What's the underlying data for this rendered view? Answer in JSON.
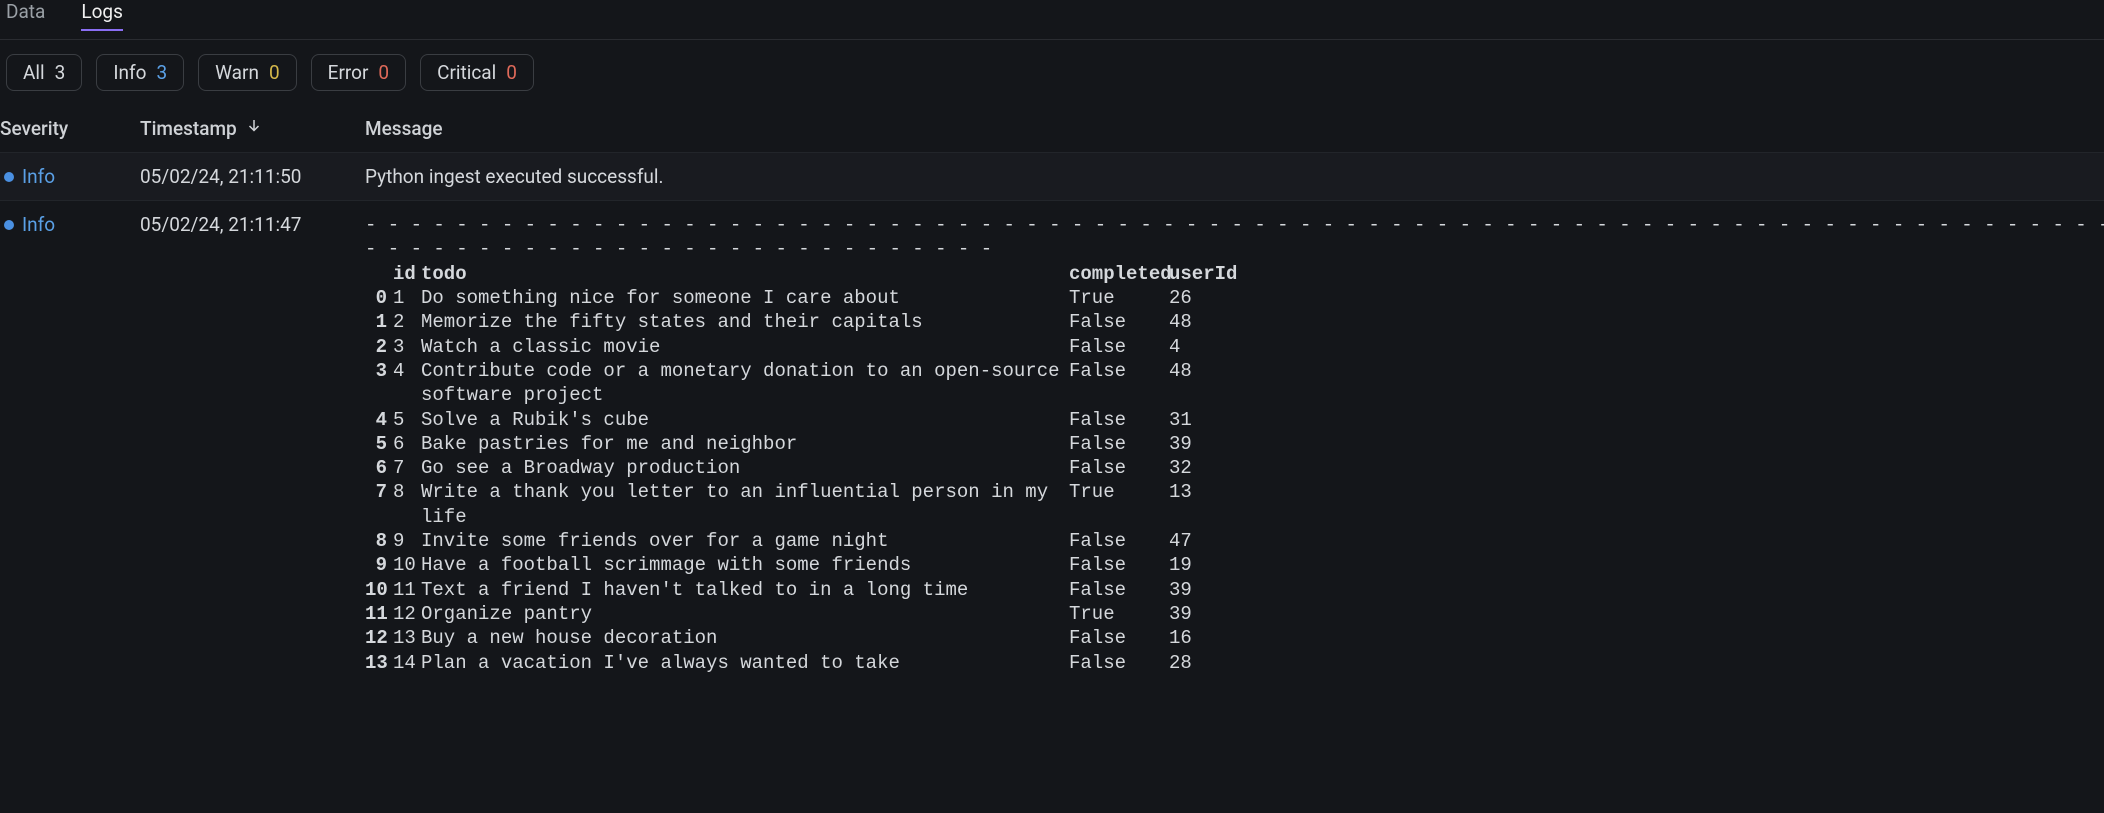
{
  "tabs": [
    {
      "label": "Data",
      "active": false
    },
    {
      "label": "Logs",
      "active": true
    }
  ],
  "filters": [
    {
      "label": "All",
      "count": "3",
      "color": "default"
    },
    {
      "label": "Info",
      "count": "3",
      "color": "blue"
    },
    {
      "label": "Warn",
      "count": "0",
      "color": "yellow"
    },
    {
      "label": "Error",
      "count": "0",
      "color": "red"
    },
    {
      "label": "Critical",
      "count": "0",
      "color": "red"
    }
  ],
  "columns": {
    "severity": "Severity",
    "timestamp": "Timestamp",
    "message": "Message"
  },
  "rows": [
    {
      "severity": "Info",
      "timestamp": "05/02/24, 21:11:50",
      "message": "Python ingest executed successful.",
      "alt": true
    },
    {
      "severity": "Info",
      "timestamp": "05/02/24, 21:11:47",
      "alt": false,
      "dataframe": {
        "headers": {
          "idx": "",
          "id": "id",
          "todo": "todo",
          "completed": "completed",
          "userId": "userId"
        },
        "rows": [
          {
            "idx": "0",
            "id": "1",
            "todo": "Do something nice for someone I care about",
            "completed": "True",
            "userId": "26"
          },
          {
            "idx": "1",
            "id": "2",
            "todo": "Memorize the fifty states and their capitals",
            "completed": "False",
            "userId": "48"
          },
          {
            "idx": "2",
            "id": "3",
            "todo": "Watch a classic movie",
            "completed": "False",
            "userId": "4"
          },
          {
            "idx": "3",
            "id": "4",
            "todo": "Contribute code or a monetary donation to an open-source software project",
            "completed": "False",
            "userId": "48"
          },
          {
            "idx": "4",
            "id": "5",
            "todo": "Solve a Rubik's cube",
            "completed": "False",
            "userId": "31"
          },
          {
            "idx": "5",
            "id": "6",
            "todo": "Bake pastries for me and neighbor",
            "completed": "False",
            "userId": "39"
          },
          {
            "idx": "6",
            "id": "7",
            "todo": "Go see a Broadway production",
            "completed": "False",
            "userId": "32"
          },
          {
            "idx": "7",
            "id": "8",
            "todo": "Write a thank you letter to an influential person in my life",
            "completed": "True",
            "userId": "13"
          },
          {
            "idx": "8",
            "id": "9",
            "todo": "Invite some friends over for a game night",
            "completed": "False",
            "userId": "47"
          },
          {
            "idx": "9",
            "id": "10",
            "todo": "Have a football scrimmage with some friends",
            "completed": "False",
            "userId": "19"
          },
          {
            "idx": "10",
            "id": "11",
            "todo": "Text a friend I haven't talked to in a long time",
            "completed": "False",
            "userId": "39"
          },
          {
            "idx": "11",
            "id": "12",
            "todo": "Organize pantry",
            "completed": "True",
            "userId": "39"
          },
          {
            "idx": "12",
            "id": "13",
            "todo": "Buy a new house decoration",
            "completed": "False",
            "userId": "16"
          },
          {
            "idx": "13",
            "id": "14",
            "todo": "Plan a vacation I've always wanted to take",
            "completed": "False",
            "userId": "28"
          }
        ]
      }
    }
  ]
}
